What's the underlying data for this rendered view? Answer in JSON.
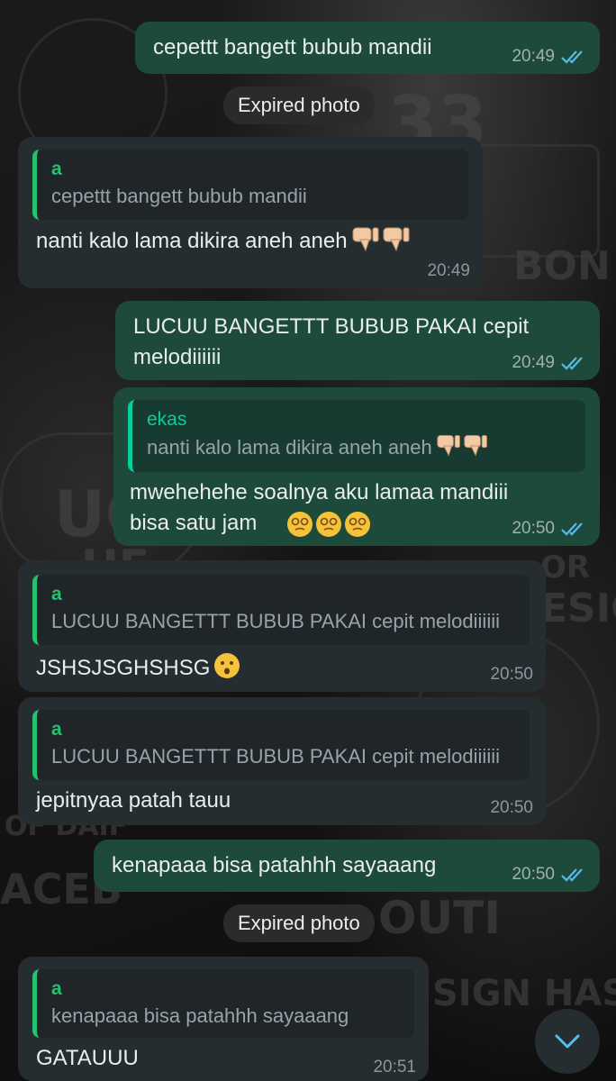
{
  "chat": {
    "messages": [
      {
        "text": "cepettt bangett bubub mandii",
        "time": "20:49"
      },
      {
        "quote_name": "a",
        "quote_text": "cepettt bangett bubub mandii",
        "text": "nanti kalo lama dikira aneh aneh",
        "time": "20:49",
        "emoji": "thumbs-down-icon"
      },
      {
        "text": "LUCUU BANGETTT BUBUB PAKAI cepit\nmelodiiiiii",
        "time": "20:49"
      },
      {
        "quote_name": "ekas",
        "quote_text": "nanti kalo lama dikira aneh aneh",
        "text": "mwehehehe soalnya aku lamaa mandiii\nbisa satu jam",
        "time": "20:50"
      },
      {
        "quote_name": "a",
        "quote_text": "LUCUU BANGETTT BUBUB PAKAI cepit melodiiiiii",
        "text": "JSHSJSGHSHSG",
        "time": "20:50"
      },
      {
        "quote_name": "a",
        "quote_text": "LUCUU BANGETTT BUBUB PAKAI cepit melodiiiiii",
        "text": "jepitnyaa patah tauu",
        "time": "20:50"
      },
      {
        "text": "kenapaaa bisa patahhh sayaaang",
        "time": "20:50"
      },
      {
        "quote_name": "a",
        "quote_text": "kenapaaa bisa patahhh sayaaang",
        "text": "GATAUUU",
        "time": "20:51"
      }
    ],
    "expired_photo_label": "Expired photo"
  },
  "wallpaper_text": [
    "33",
    "BON",
    "SIGN HAS",
    "ACEB",
    "UC",
    "HE",
    "ESIG",
    "OUTI",
    "OF DAIF",
    "OR"
  ],
  "colors": {
    "outgoing": "#1e4a3c",
    "incoming": "#262d31",
    "read_ticks": "#53bdeb",
    "quote_bar": "#25c16f"
  }
}
